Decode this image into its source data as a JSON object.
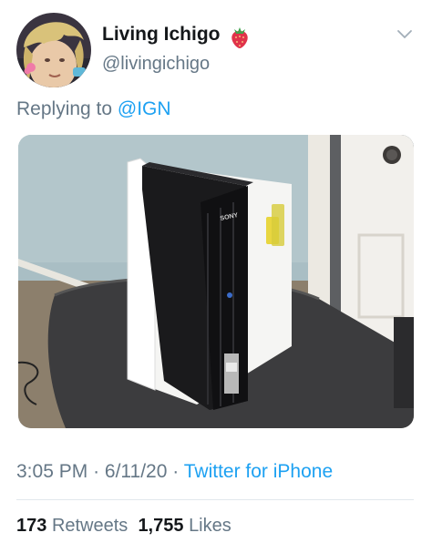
{
  "tweet": {
    "author": {
      "display_name": "Living Ichigo",
      "handle": "@livingichigo",
      "name_emoji": "strawberry-icon"
    },
    "reply_prefix": "Replying to",
    "reply_to": "@IGN",
    "media": {
      "description_icon": "photo-ps2-binder"
    },
    "time": "3:05 PM",
    "separator": "·",
    "date": "6/11/20",
    "source": "Twitter for iPhone",
    "retweets_count": "173",
    "retweets_label": "Retweets",
    "likes_count": "1,755",
    "likes_label": "Likes"
  },
  "colors": {
    "link": "#1da1f2",
    "secondary_text": "#657786",
    "primary_text": "#14171a",
    "divider": "#e1e8ed"
  }
}
